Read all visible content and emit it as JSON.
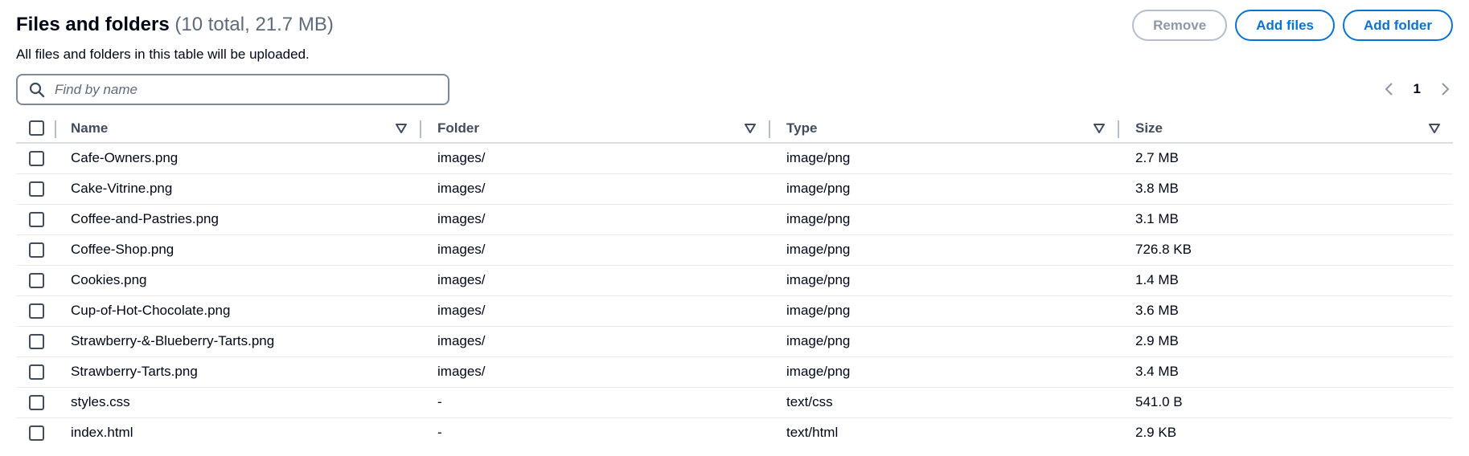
{
  "header": {
    "title": "Files and folders",
    "count": "(10 total, 21.7 MB)",
    "description": "All files and folders in this table will be uploaded."
  },
  "actions": {
    "remove_label": "Remove",
    "add_files_label": "Add files",
    "add_folder_label": "Add folder"
  },
  "search": {
    "placeholder": "Find by name",
    "value": ""
  },
  "pagination": {
    "current_page": "1"
  },
  "table": {
    "columns": [
      "Name",
      "Folder",
      "Type",
      "Size"
    ],
    "rows": [
      {
        "name": "Cafe-Owners.png",
        "folder": "images/",
        "type": "image/png",
        "size": "2.7 MB"
      },
      {
        "name": "Cake-Vitrine.png",
        "folder": "images/",
        "type": "image/png",
        "size": "3.8 MB"
      },
      {
        "name": "Coffee-and-Pastries.png",
        "folder": "images/",
        "type": "image/png",
        "size": "3.1 MB"
      },
      {
        "name": "Coffee-Shop.png",
        "folder": "images/",
        "type": "image/png",
        "size": "726.8 KB"
      },
      {
        "name": "Cookies.png",
        "folder": "images/",
        "type": "image/png",
        "size": "1.4 MB"
      },
      {
        "name": "Cup-of-Hot-Chocolate.png",
        "folder": "images/",
        "type": "image/png",
        "size": "3.6 MB"
      },
      {
        "name": "Strawberry-&-Blueberry-Tarts.png",
        "folder": "images/",
        "type": "image/png",
        "size": "2.9 MB"
      },
      {
        "name": "Strawberry-Tarts.png",
        "folder": "images/",
        "type": "image/png",
        "size": "3.4 MB"
      },
      {
        "name": "styles.css",
        "folder": "-",
        "type": "text/css",
        "size": "541.0 B"
      },
      {
        "name": "index.html",
        "folder": "-",
        "type": "text/html",
        "size": "2.9 KB"
      }
    ]
  },
  "colors": {
    "primary": "#0972d3",
    "text": "#000716",
    "muted": "#5f6b7a",
    "disabled": "#8d99a8"
  },
  "icons": {
    "search": "search-icon",
    "sort": "caret-down-icon",
    "prev": "chevron-left-icon",
    "next": "chevron-right-icon"
  }
}
